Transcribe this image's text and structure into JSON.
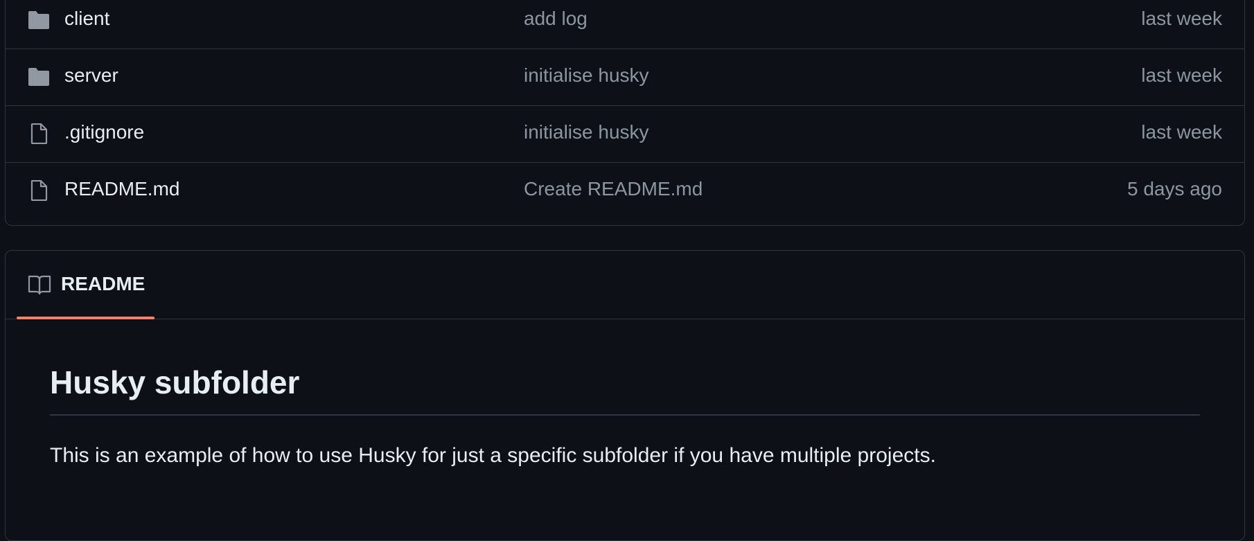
{
  "files": [
    {
      "name": "client",
      "type": "folder",
      "icon": "folder-icon",
      "commit": "add log",
      "date": "last week"
    },
    {
      "name": "server",
      "type": "folder",
      "icon": "folder-icon",
      "commit": "initialise husky",
      "date": "last week"
    },
    {
      "name": ".gitignore",
      "type": "file",
      "icon": "file-icon",
      "commit": "initialise husky",
      "date": "last week"
    },
    {
      "name": "README.md",
      "type": "file",
      "icon": "file-icon",
      "commit": "Create README.md",
      "date": "5 days ago"
    }
  ],
  "readme": {
    "tab_label": "README",
    "tab_icon": "book-icon",
    "title": "Husky subfolder",
    "paragraph": "This is an example of how to use Husky for just a specific subfolder if you have multiple projects."
  },
  "colors": {
    "background": "#0d1117",
    "border": "#30363d",
    "text": "#e6edf3",
    "muted": "#8d96a0",
    "icon": "#9198a1",
    "accent_underline": "#f78166"
  }
}
